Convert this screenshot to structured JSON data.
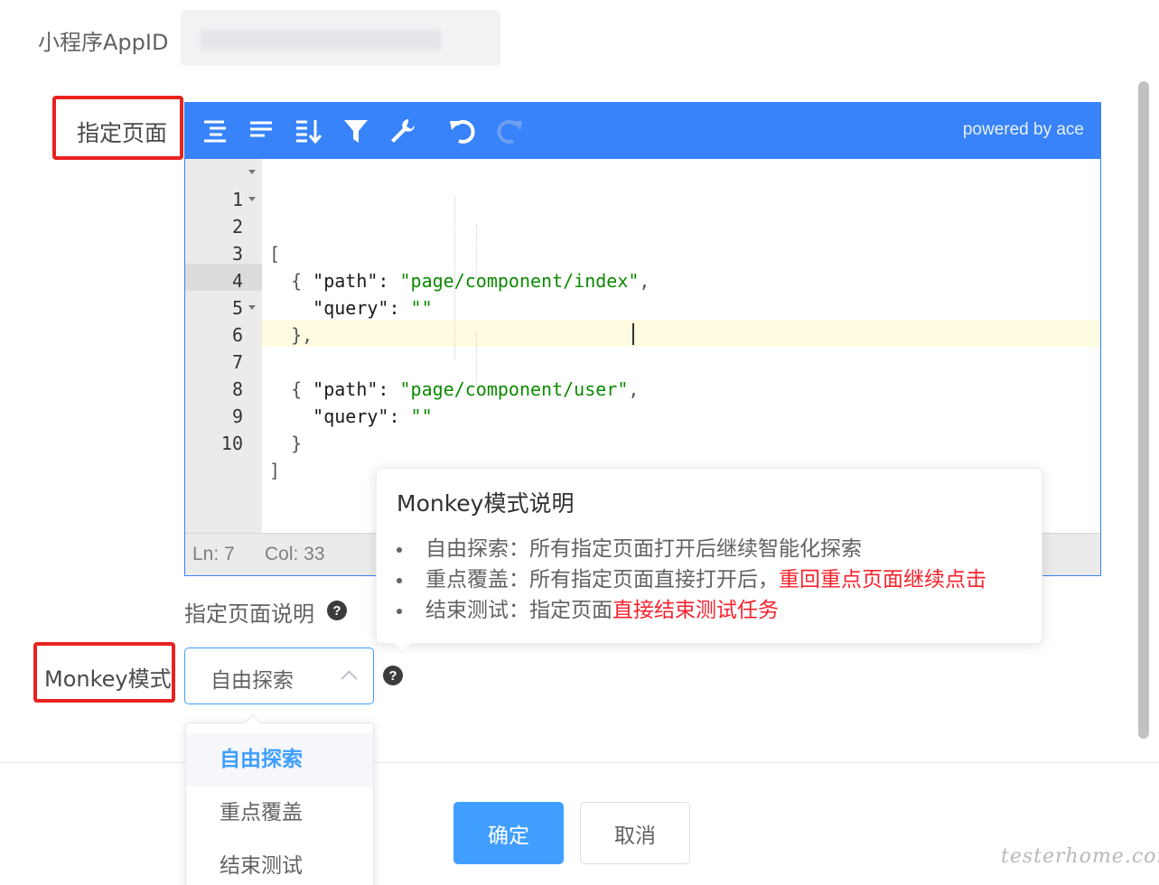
{
  "form": {
    "appid_label": "小程序AppID",
    "page_label": "指定页面",
    "page_desc_label": "指定页面说明",
    "monkey_label": "Monkey模式"
  },
  "editor": {
    "powered_by": "powered by ace",
    "toolbar_icons": [
      "format-icon",
      "compact-icon",
      "sort-icon",
      "filter-icon",
      "repair-icon",
      "undo-icon",
      "redo-icon"
    ],
    "lines": [
      {
        "n": "1",
        "code": "["
      },
      {
        "n": "2",
        "code": "  {"
      },
      {
        "n": "3",
        "code": "    \"path\": \"page/component/index\","
      },
      {
        "n": "4",
        "code": "    \"query\": \"\""
      },
      {
        "n": "5",
        "code": "  },"
      },
      {
        "n": "6",
        "code": "  {"
      },
      {
        "n": "7",
        "code": "    \"path\": \"page/component/user\","
      },
      {
        "n": "8",
        "code": "    \"query\": \"\""
      },
      {
        "n": "9",
        "code": "  }"
      },
      {
        "n": "10",
        "code": "]"
      }
    ],
    "status_ln": "Ln: 7",
    "status_col": "Col: 33"
  },
  "select": {
    "value": "自由探索",
    "options": [
      "自由探索",
      "重点覆盖",
      "结束测试"
    ]
  },
  "popover": {
    "title": "Monkey模式说明",
    "item1": "自由探索：所有指定页面打开后继续智能化探索",
    "item2_prefix": "重点覆盖：所有指定页面直接打开后，",
    "item2_red": "重回重点页面继续点击",
    "item3_prefix": "结束测试：指定页面",
    "item3_red": "直接结束测试任务"
  },
  "buttons": {
    "ok": "确定",
    "cancel": "取消"
  },
  "watermark": "testerhome.com",
  "colors": {
    "accent": "#3883fa",
    "primary": "#409eff",
    "highlight_red": "#f5222d",
    "annotation_red": "#e8231f"
  }
}
